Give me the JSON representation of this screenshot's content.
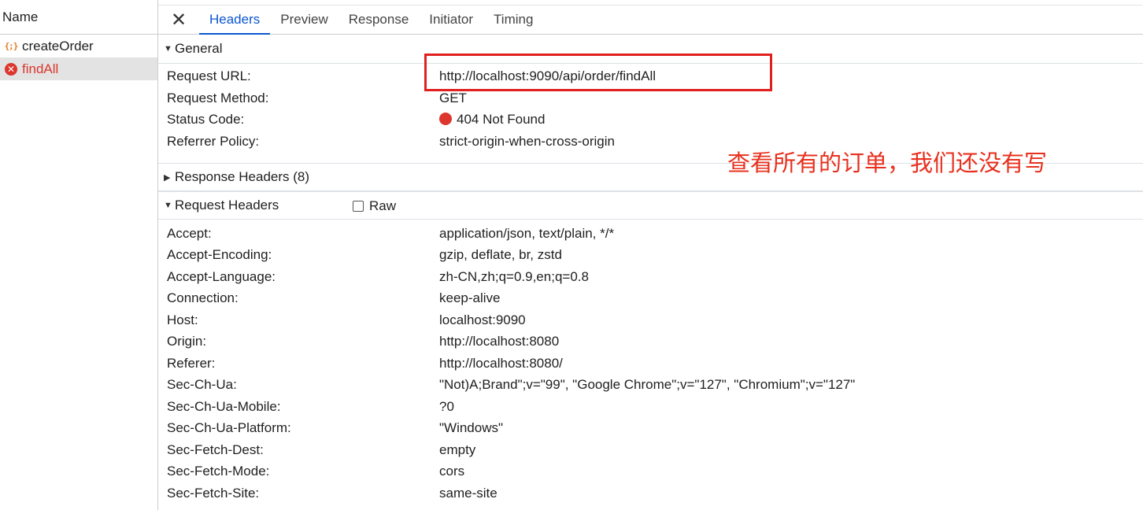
{
  "request_list": {
    "header": "Name",
    "items": [
      {
        "name": "createOrder",
        "icon": "fetch-icon"
      },
      {
        "name": "findAll",
        "icon": "error-icon"
      }
    ]
  },
  "tabs": {
    "close_glyph": "✕",
    "items": [
      "Headers",
      "Preview",
      "Response",
      "Initiator",
      "Timing"
    ],
    "active": "Headers"
  },
  "general": {
    "title": "General",
    "rows": [
      {
        "key": "Request URL:",
        "value": "http://localhost:9090/api/order/findAll"
      },
      {
        "key": "Request Method:",
        "value": "GET"
      },
      {
        "key": "Status Code:",
        "value": "404 Not Found"
      },
      {
        "key": "Referrer Policy:",
        "value": "strict-origin-when-cross-origin"
      }
    ]
  },
  "response_headers": {
    "title": "Response Headers (8)"
  },
  "request_headers": {
    "title": "Request Headers",
    "raw_label": "Raw",
    "rows": [
      {
        "key": "Accept:",
        "value": "application/json, text/plain, */*"
      },
      {
        "key": "Accept-Encoding:",
        "value": "gzip, deflate, br, zstd"
      },
      {
        "key": "Accept-Language:",
        "value": "zh-CN,zh;q=0.9,en;q=0.8"
      },
      {
        "key": "Connection:",
        "value": "keep-alive"
      },
      {
        "key": "Host:",
        "value": "localhost:9090"
      },
      {
        "key": "Origin:",
        "value": "http://localhost:8080"
      },
      {
        "key": "Referer:",
        "value": "http://localhost:8080/"
      },
      {
        "key": "Sec-Ch-Ua:",
        "value": "\"Not)A;Brand\";v=\"99\", \"Google Chrome\";v=\"127\", \"Chromium\";v=\"127\""
      },
      {
        "key": "Sec-Ch-Ua-Mobile:",
        "value": "?0"
      },
      {
        "key": "Sec-Ch-Ua-Platform:",
        "value": "\"Windows\""
      },
      {
        "key": "Sec-Fetch-Dest:",
        "value": "empty"
      },
      {
        "key": "Sec-Fetch-Mode:",
        "value": "cors"
      },
      {
        "key": "Sec-Fetch-Site:",
        "value": "same-site"
      }
    ]
  },
  "annotation": {
    "text": "查看所有的订单，我们还没有写"
  },
  "colors": {
    "accent": "#0b57d0",
    "error": "#dc362e",
    "annotation": "#e0201e"
  }
}
